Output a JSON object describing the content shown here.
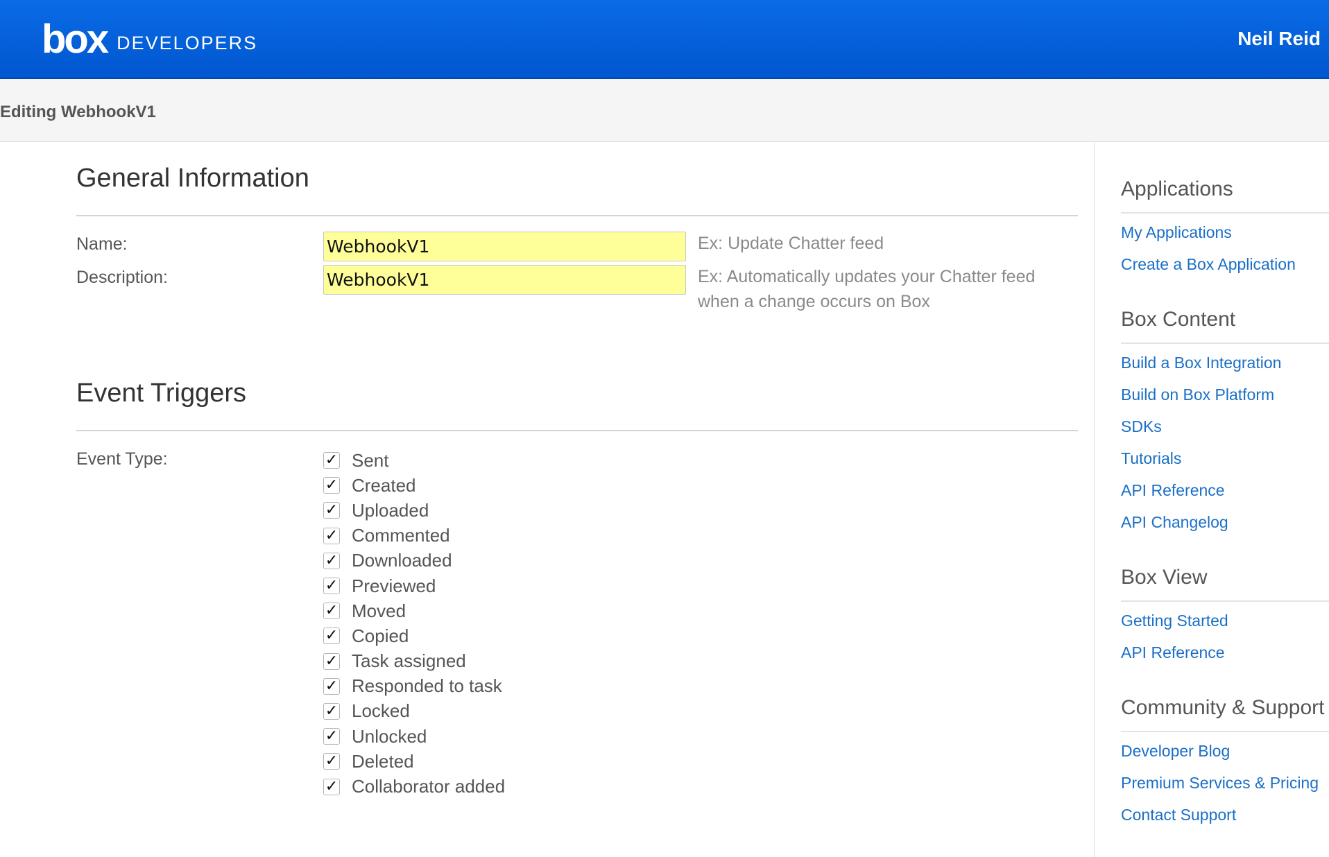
{
  "header": {
    "logo_text": "box",
    "brand_text": "DEVELOPERS",
    "user_name": "Neil Reid"
  },
  "subheader": {
    "title": "Editing WebhookV1"
  },
  "general": {
    "title": "General Information",
    "name_label": "Name:",
    "name_value": "WebhookV1",
    "name_hint": "Ex: Update Chatter feed",
    "description_label": "Description:",
    "description_value": "WebhookV1",
    "description_hint_line1": "Ex: Automatically updates your Chatter feed",
    "description_hint_line2": "when a change occurs on Box"
  },
  "events": {
    "title": "Event Triggers",
    "label": "Event Type:",
    "items": [
      {
        "label": "Sent",
        "checked": true
      },
      {
        "label": "Created",
        "checked": true
      },
      {
        "label": "Uploaded",
        "checked": true
      },
      {
        "label": "Commented",
        "checked": true
      },
      {
        "label": "Downloaded",
        "checked": true
      },
      {
        "label": "Previewed",
        "checked": true
      },
      {
        "label": "Moved",
        "checked": true
      },
      {
        "label": "Copied",
        "checked": true
      },
      {
        "label": "Task assigned",
        "checked": true
      },
      {
        "label": "Responded to task",
        "checked": true
      },
      {
        "label": "Locked",
        "checked": true
      },
      {
        "label": "Unlocked",
        "checked": true
      },
      {
        "label": "Deleted",
        "checked": true
      },
      {
        "label": "Collaborator added",
        "checked": true
      }
    ]
  },
  "sidebar": {
    "groups": [
      {
        "heading": "Applications",
        "links": [
          "My Applications",
          "Create a Box Application"
        ]
      },
      {
        "heading": "Box Content",
        "links": [
          "Build a Box Integration",
          "Build on Box Platform",
          "SDKs",
          "Tutorials",
          "API Reference",
          "API Changelog"
        ]
      },
      {
        "heading": "Box View",
        "links": [
          "Getting Started",
          "API Reference"
        ]
      },
      {
        "heading": "Community & Support",
        "links": [
          "Developer Blog",
          "Premium Services & Pricing",
          "Contact Support"
        ]
      }
    ]
  },
  "colors": {
    "header_blue": "#0061d5",
    "link_blue": "#1a6fc7",
    "input_highlight": "#ffff99"
  }
}
